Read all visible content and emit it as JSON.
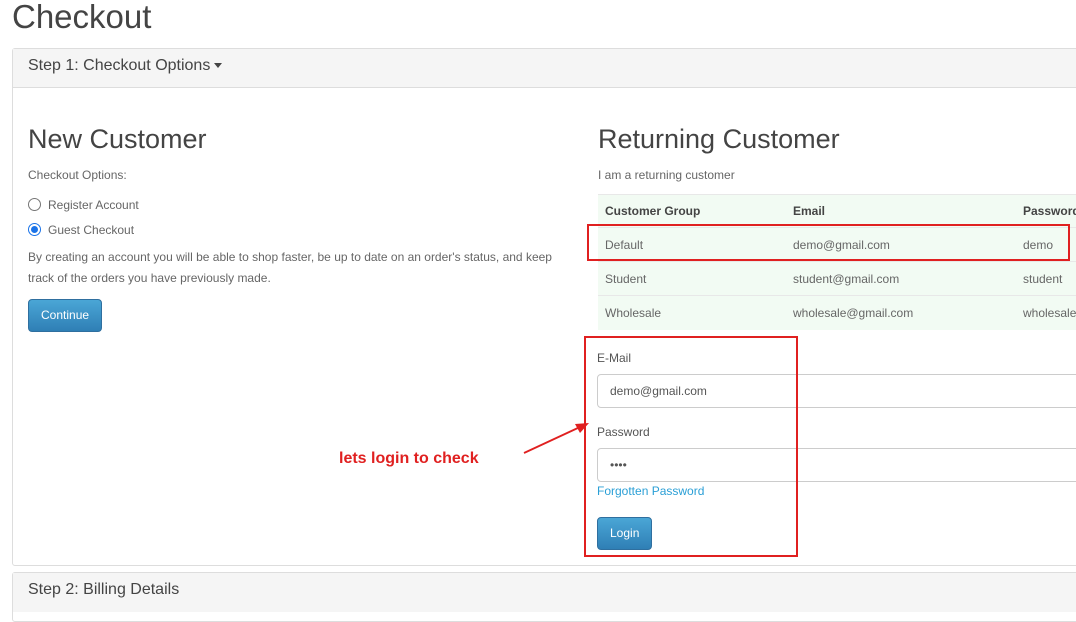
{
  "page": {
    "title": "Checkout"
  },
  "step1": {
    "heading": "Step 1: Checkout Options"
  },
  "new_customer": {
    "title": "New Customer",
    "options_label": "Checkout Options:",
    "options": [
      {
        "label": "Register Account",
        "checked": false
      },
      {
        "label": "Guest Checkout",
        "checked": true
      }
    ],
    "description": "By creating an account you will be able to shop faster, be up to date on an order's status, and keep track of the orders you have previously made.",
    "continue_label": "Continue"
  },
  "returning_customer": {
    "title": "Returning Customer",
    "subtitle": "I am a returning customer",
    "table": {
      "headers": [
        "Customer Group",
        "Email",
        "Password"
      ],
      "rows": [
        [
          "Default",
          "demo@gmail.com",
          "demo"
        ],
        [
          "Student",
          "student@gmail.com",
          "student"
        ],
        [
          "Wholesale",
          "wholesale@gmail.com",
          "wholesale"
        ]
      ]
    },
    "email_label": "E-Mail",
    "email_value": "demo@gmail.com",
    "password_label": "Password",
    "password_value": "demo",
    "forgot_label": "Forgotten Password",
    "login_label": "Login"
  },
  "annotation": {
    "text": "lets login to check",
    "color": "#e02020"
  },
  "step2": {
    "heading": "Step 2: Billing Details"
  }
}
